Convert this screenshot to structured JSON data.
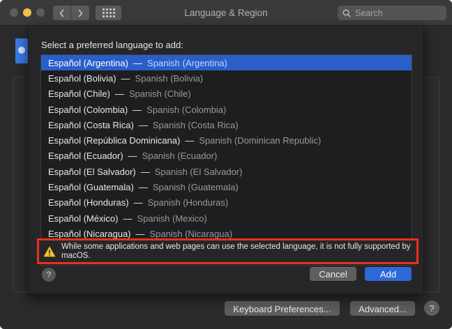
{
  "window": {
    "title": "Language & Region",
    "search_placeholder": "Search"
  },
  "sheet": {
    "prompt": "Select a preferred language to add:",
    "languages": [
      {
        "native": "Español (Argentina)",
        "english": "Spanish (Argentina)",
        "selected": true
      },
      {
        "native": "Español (Bolivia)",
        "english": "Spanish (Bolivia)"
      },
      {
        "native": "Español (Chile)",
        "english": "Spanish (Chile)"
      },
      {
        "native": "Español (Colombia)",
        "english": "Spanish (Colombia)"
      },
      {
        "native": "Español (Costa Rica)",
        "english": "Spanish (Costa Rica)"
      },
      {
        "native": "Español (República Dominicana)",
        "english": "Spanish (Dominican Republic)"
      },
      {
        "native": "Español (Ecuador)",
        "english": "Spanish (Ecuador)"
      },
      {
        "native": "Español (El Salvador)",
        "english": "Spanish (El Salvador)"
      },
      {
        "native": "Español (Guatemala)",
        "english": "Spanish (Guatemala)"
      },
      {
        "native": "Español (Honduras)",
        "english": "Spanish (Honduras)"
      },
      {
        "native": "Español (México)",
        "english": "Spanish (Mexico)"
      },
      {
        "native": "Español (Nicaragua)",
        "english": "Spanish (Nicaragua)"
      }
    ],
    "separator": "—",
    "warning": "While some applications and web pages can use the selected language, it is not fully supported by macOS.",
    "help_label": "?",
    "cancel_label": "Cancel",
    "add_label": "Add"
  },
  "bottom": {
    "keyboard_prefs_label": "Keyboard Preferences...",
    "advanced_label": "Advanced...",
    "help_label": "?"
  },
  "colors": {
    "selection": "#2a5fc9",
    "add_button": "#2e69d8",
    "warning_outline": "#e8311f",
    "minimize_light": "#f5bf4f"
  },
  "icons": {
    "back": "chevron-left-icon",
    "forward": "chevron-right-icon",
    "grid": "show-all-grid-icon",
    "search": "magnifier-icon",
    "warning": "warning-triangle-icon"
  }
}
